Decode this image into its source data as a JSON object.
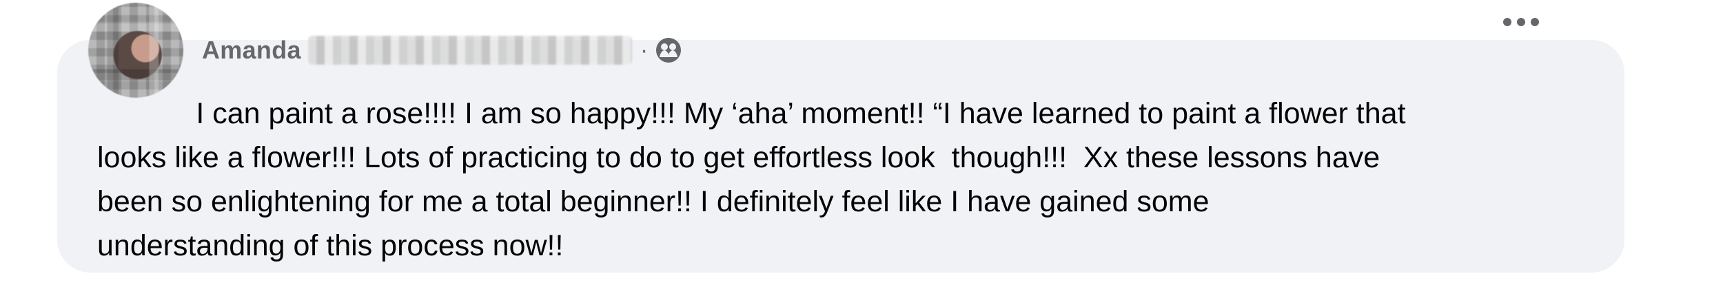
{
  "post": {
    "author_name": "Amanda",
    "meta_separator": "·",
    "audience_icon": "friends-icon",
    "more_icon": "more-options-icon",
    "text": "            I can paint a rose!!!! I am so happy!!! My ‘aha’ moment!! “I have learned to paint a flower that\nlooks like a flower!!! Lots of practicing to do to get effortless look  though!!!  Xx these lessons have\nbeen so enlightening for me a total beginner!! I definitely feel like I have gained some\nunderstanding of this process now!!"
  },
  "colors": {
    "card_background": "#f0f2f5",
    "secondary_text": "#65676b",
    "primary_text": "#050505"
  }
}
